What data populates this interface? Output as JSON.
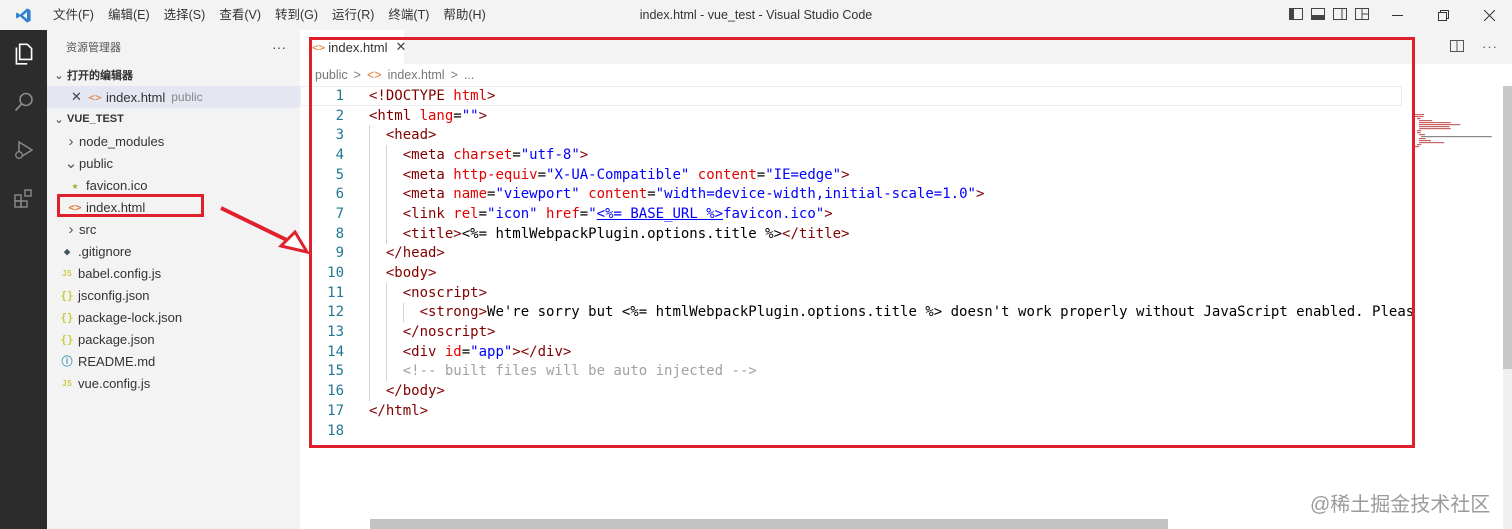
{
  "menu": [
    "文件(F)",
    "编辑(E)",
    "选择(S)",
    "查看(V)",
    "转到(G)",
    "运行(R)",
    "终端(T)",
    "帮助(H)"
  ],
  "window_title": "index.html - vue_test - Visual Studio Code",
  "activity_icons": [
    "explorer-icon",
    "search-icon",
    "run-debug-icon",
    "extensions-icon"
  ],
  "sidebar": {
    "header": "资源管理器",
    "more": "···",
    "open_editors_label": "打开的编辑器",
    "open_editors": [
      {
        "name": "index.html",
        "folder": "public",
        "icon": "html-file-icon"
      }
    ],
    "project_label": "VUE_TEST",
    "tree": [
      {
        "name": "node_modules",
        "kind": "folder-collapsed"
      },
      {
        "name": "public",
        "kind": "folder-expanded"
      },
      {
        "name": "favicon.ico",
        "kind": "file",
        "icon": "★",
        "icon_color": "#a7a728"
      },
      {
        "name": "index.html",
        "kind": "file",
        "icon": "<>",
        "icon_color": "#e37933"
      },
      {
        "name": "src",
        "kind": "folder-collapsed"
      },
      {
        "name": ".gitignore",
        "kind": "file",
        "icon": "◆",
        "icon_color": "#41535b"
      },
      {
        "name": "babel.config.js",
        "kind": "file",
        "icon": "JS",
        "icon_color": "#cbcb41"
      },
      {
        "name": "jsconfig.json",
        "kind": "file",
        "icon": "{}",
        "icon_color": "#cbcb41"
      },
      {
        "name": "package-lock.json",
        "kind": "file",
        "icon": "{}",
        "icon_color": "#cbcb41"
      },
      {
        "name": "package.json",
        "kind": "file",
        "icon": "{}",
        "icon_color": "#cbcb41"
      },
      {
        "name": "README.md",
        "kind": "file",
        "icon": "ⓘ",
        "icon_color": "#519aba"
      },
      {
        "name": "vue.config.js",
        "kind": "file",
        "icon": "JS",
        "icon_color": "#cbcb41"
      }
    ]
  },
  "editor": {
    "tab": {
      "label": "index.html",
      "close": "✕"
    },
    "breadcrumb": [
      "public",
      ">",
      "<>",
      "index.html",
      ">",
      "..."
    ],
    "lines": [
      {
        "n": "1",
        "indent": 0,
        "tokens": [
          [
            "tag",
            "<!DOCTYPE "
          ],
          [
            "attr",
            "html"
          ],
          [
            "tag",
            ">"
          ]
        ]
      },
      {
        "n": "2",
        "indent": 0,
        "tokens": [
          [
            "tag",
            "<html "
          ],
          [
            "attr",
            "lang"
          ],
          [
            "plain",
            "="
          ],
          [
            "str",
            "\"\""
          ],
          [
            "tag",
            ">"
          ]
        ]
      },
      {
        "n": "3",
        "indent": 1,
        "tokens": [
          [
            "tag",
            "<head>"
          ]
        ]
      },
      {
        "n": "4",
        "indent": 2,
        "tokens": [
          [
            "tag",
            "<meta "
          ],
          [
            "attr",
            "charset"
          ],
          [
            "plain",
            "="
          ],
          [
            "str",
            "\"utf-8\""
          ],
          [
            "tag",
            ">"
          ]
        ]
      },
      {
        "n": "5",
        "indent": 2,
        "tokens": [
          [
            "tag",
            "<meta "
          ],
          [
            "attr",
            "http-equiv"
          ],
          [
            "plain",
            "="
          ],
          [
            "str",
            "\"X-UA-Compatible\""
          ],
          [
            "plain",
            " "
          ],
          [
            "attr",
            "content"
          ],
          [
            "plain",
            "="
          ],
          [
            "str",
            "\"IE=edge\""
          ],
          [
            "tag",
            ">"
          ]
        ]
      },
      {
        "n": "6",
        "indent": 2,
        "tokens": [
          [
            "tag",
            "<meta "
          ],
          [
            "attr",
            "name"
          ],
          [
            "plain",
            "="
          ],
          [
            "str",
            "\"viewport\""
          ],
          [
            "plain",
            " "
          ],
          [
            "attr",
            "content"
          ],
          [
            "plain",
            "="
          ],
          [
            "str",
            "\"width=device-width,initial-scale=1.0\""
          ],
          [
            "tag",
            ">"
          ]
        ]
      },
      {
        "n": "7",
        "indent": 2,
        "tokens": [
          [
            "tag",
            "<link "
          ],
          [
            "attr",
            "rel"
          ],
          [
            "plain",
            "="
          ],
          [
            "str",
            "\"icon\""
          ],
          [
            "plain",
            " "
          ],
          [
            "attr",
            "href"
          ],
          [
            "plain",
            "="
          ],
          [
            "str",
            "\""
          ],
          [
            "ul",
            "<%= BASE_URL %>"
          ],
          [
            "str",
            "favicon.ico\""
          ],
          [
            "tag",
            ">"
          ]
        ]
      },
      {
        "n": "8",
        "indent": 2,
        "tokens": [
          [
            "tag",
            "<title>"
          ],
          [
            "plain",
            "<%= htmlWebpackPlugin.options.title %>"
          ],
          [
            "tag",
            "</title>"
          ]
        ]
      },
      {
        "n": "9",
        "indent": 1,
        "tokens": [
          [
            "tag",
            "</head>"
          ]
        ]
      },
      {
        "n": "10",
        "indent": 1,
        "tokens": [
          [
            "tag",
            "<body>"
          ]
        ]
      },
      {
        "n": "11",
        "indent": 2,
        "tokens": [
          [
            "tag",
            "<noscript>"
          ]
        ]
      },
      {
        "n": "12",
        "indent": 3,
        "tokens": [
          [
            "tag",
            "<strong>"
          ],
          [
            "plain",
            "We're sorry but <%= htmlWebpackPlugin.options.title %> doesn't work properly without JavaScript enabled. Pleas"
          ]
        ]
      },
      {
        "n": "13",
        "indent": 2,
        "tokens": [
          [
            "tag",
            "</noscript>"
          ]
        ]
      },
      {
        "n": "14",
        "indent": 2,
        "tokens": [
          [
            "tag",
            "<div "
          ],
          [
            "attr",
            "id"
          ],
          [
            "plain",
            "="
          ],
          [
            "str",
            "\"app\""
          ],
          [
            "tag",
            "></div>"
          ]
        ]
      },
      {
        "n": "15",
        "indent": 2,
        "tokens": [
          [
            "cmt",
            "<!-- built files will be auto injected -->"
          ]
        ]
      },
      {
        "n": "16",
        "indent": 1,
        "tokens": [
          [
            "tag",
            "</body>"
          ]
        ]
      },
      {
        "n": "17",
        "indent": 0,
        "tokens": [
          [
            "tag",
            "</html>"
          ]
        ]
      },
      {
        "n": "18",
        "indent": 0,
        "tokens": []
      }
    ]
  },
  "watermark": "@稀土掘金技术社区",
  "colors": {
    "highlight": "#e0202d",
    "activity_bg": "#2c2c2c",
    "sidebar_bg": "#f3f3f3",
    "tag": "#800000",
    "attr": "#e50000",
    "string": "#0000ff",
    "line_number": "#237893"
  }
}
